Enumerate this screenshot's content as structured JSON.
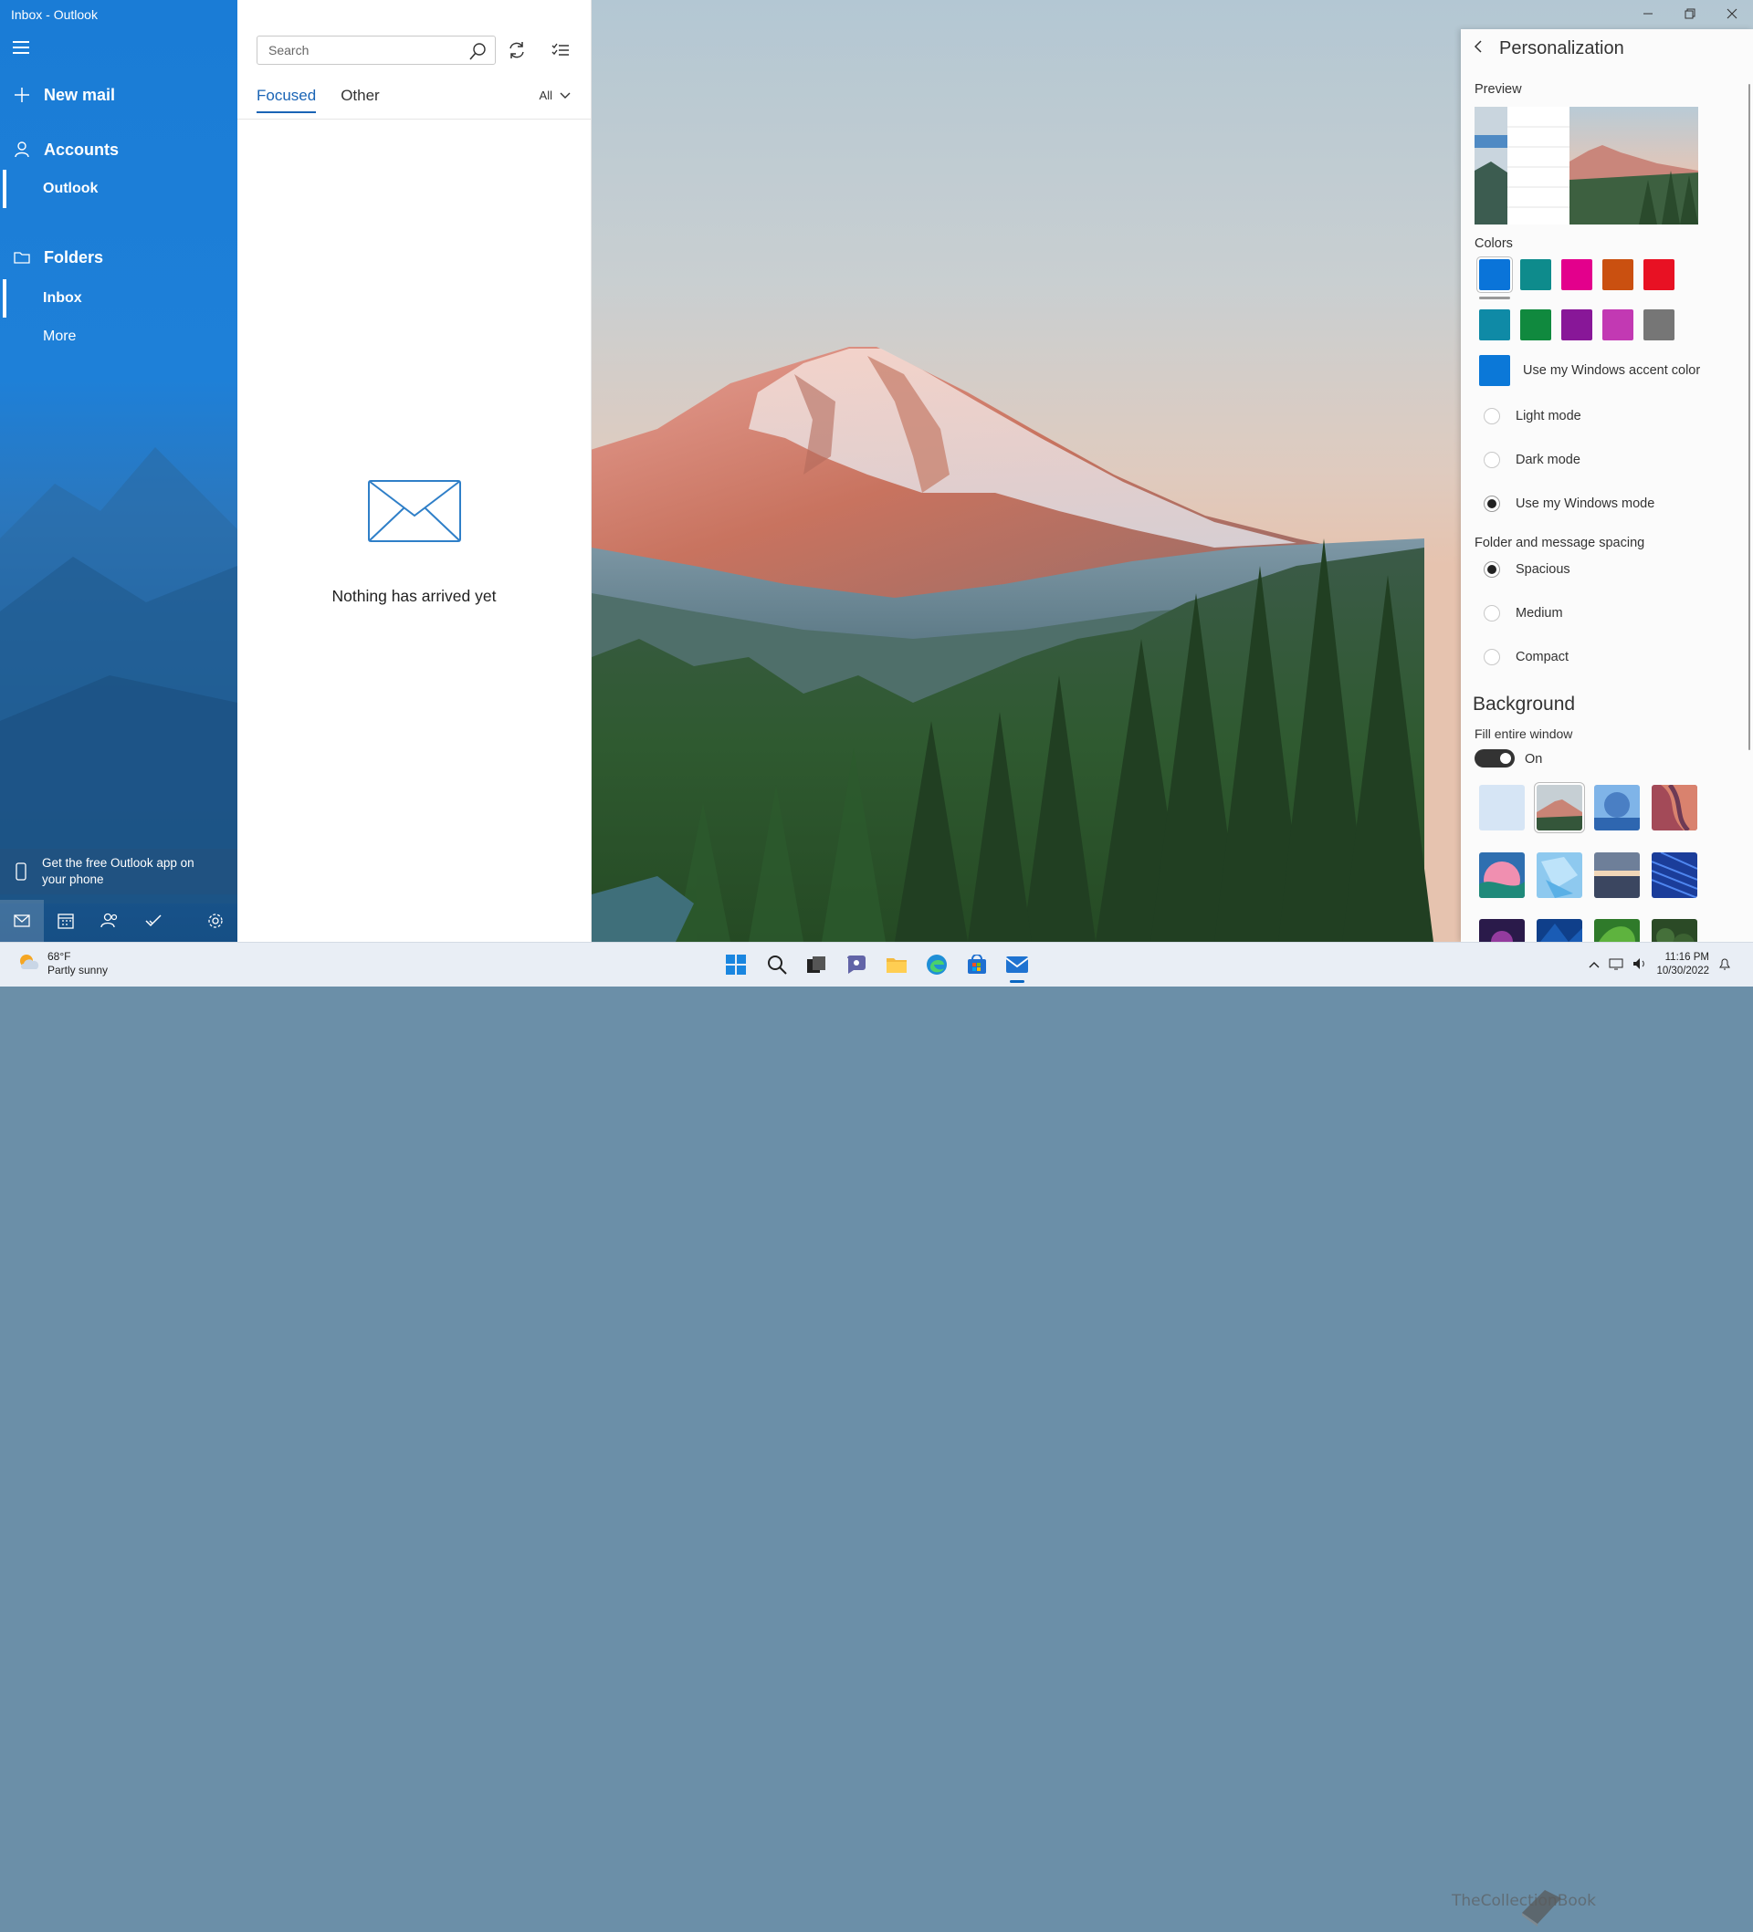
{
  "window": {
    "title": "Inbox - Outlook"
  },
  "nav": {
    "new_mail": "New mail",
    "accounts_heading": "Accounts",
    "account": "Outlook",
    "folders_heading": "Folders",
    "folders": [
      "Inbox",
      "More"
    ],
    "get_app": "Get the free Outlook app on your phone",
    "bottom_icons": [
      "mail-icon",
      "calendar-icon",
      "people-icon",
      "todo-icon",
      "settings-icon"
    ]
  },
  "list": {
    "search_placeholder": "Search",
    "tabs": [
      "Focused",
      "Other"
    ],
    "active_tab": "Focused",
    "filter": "All",
    "empty_message": "Nothing has arrived yet"
  },
  "panel": {
    "title": "Personalization",
    "preview_label": "Preview",
    "colors_label": "Colors",
    "colors_row1": [
      "#0a74d9",
      "#0e8b8c",
      "#e3008c",
      "#ca5010",
      "#e81123"
    ],
    "colors_row2": [
      "#0f8aa6",
      "#10893e",
      "#881798",
      "#c239b3",
      "#767676"
    ],
    "selected_color": "#0a74d9",
    "accent_color": "#0b78d8",
    "accent_option": "Use my Windows accent color",
    "mode_options": [
      "Light mode",
      "Dark mode",
      "Use my Windows mode"
    ],
    "selected_mode": "Use my Windows mode",
    "spacing_label": "Folder and message spacing",
    "spacing_options": [
      "Spacious",
      "Medium",
      "Compact"
    ],
    "selected_spacing": "Spacious",
    "background_title": "Background",
    "fill_label": "Fill entire window",
    "fill_state": "On"
  },
  "taskbar": {
    "temperature": "68°F",
    "condition": "Partly sunny",
    "time": "11:16 PM",
    "date": "10/30/2022",
    "apps": [
      "start-icon",
      "search-icon",
      "task-view-icon",
      "chat-icon",
      "file-explorer-icon",
      "edge-icon",
      "store-icon",
      "mail-icon"
    ]
  },
  "watermark": "TheCollectionBook"
}
